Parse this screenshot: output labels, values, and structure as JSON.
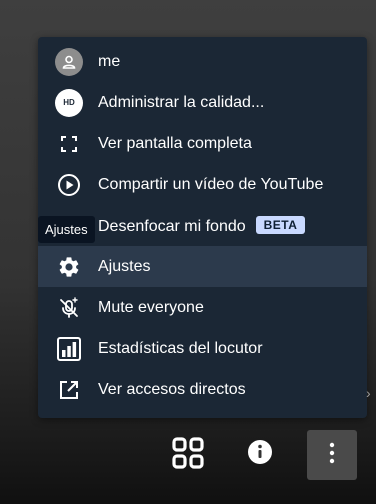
{
  "menu": {
    "items": [
      {
        "label": "me",
        "icon": "avatar-icon"
      },
      {
        "label": "Administrar la calidad...",
        "icon": "hd-icon",
        "badge_text": "HD"
      },
      {
        "label": "Ver pantalla completa",
        "icon": "fullscreen-icon"
      },
      {
        "label": "Compartir un vídeo de YouTube",
        "icon": "play-circle-icon"
      },
      {
        "label": "Desenfocar mi fondo",
        "icon": "blur-icon",
        "badge": "BETA"
      },
      {
        "label": "Ajustes",
        "icon": "gear-icon"
      },
      {
        "label": "Mute everyone",
        "icon": "mute-icon"
      },
      {
        "label": "Estadísticas del locutor",
        "icon": "stats-icon"
      },
      {
        "label": "Ver accesos directos",
        "icon": "open-external-icon"
      }
    ]
  },
  "tooltip": {
    "text": "Ajustes"
  },
  "toolbar": {
    "buttons": [
      {
        "name": "tile-view",
        "icon": "tile-grid-icon"
      },
      {
        "name": "info",
        "icon": "info-icon"
      },
      {
        "name": "more",
        "icon": "more-vertical-icon"
      }
    ]
  },
  "colors": {
    "menu_bg": "#1b2735",
    "menu_hover": "#2c3a4c",
    "beta_badge": "#c9d9ff",
    "tooltip_bg": "#0a1422"
  }
}
